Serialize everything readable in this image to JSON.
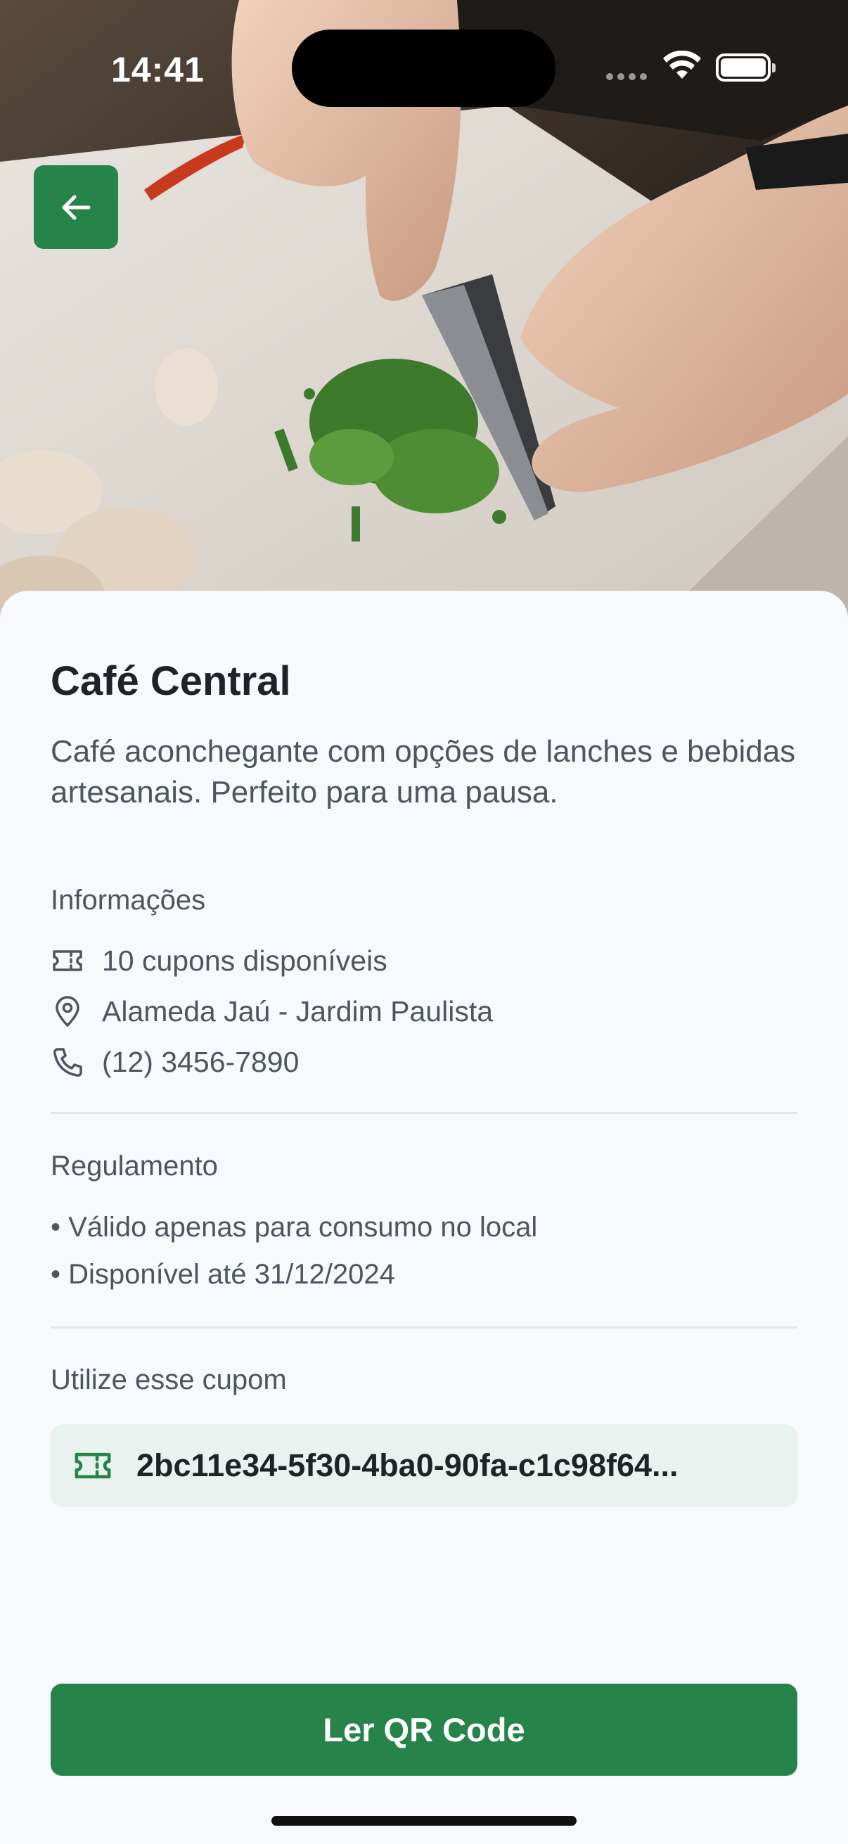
{
  "status_bar": {
    "time": "14:41"
  },
  "hero": {
    "image_description": "",
    "back_icon": "arrow-left-icon"
  },
  "place": {
    "name": "Café Central",
    "description": "Café aconchegante com opções de lanches e bebidas artesanais. Perfeito para uma pausa."
  },
  "info": {
    "heading": "Informações",
    "items": [
      {
        "icon": "ticket-icon",
        "text": "10 cupons disponíveis"
      },
      {
        "icon": "location-pin-icon",
        "text": "Alameda Jaú - Jardim Paulista"
      },
      {
        "icon": "phone-icon",
        "text": "(12) 3456-7890"
      }
    ]
  },
  "rules": {
    "heading": "Regulamento",
    "items": [
      "• Válido apenas para consumo no local",
      "• Disponível até 31/12/2024"
    ]
  },
  "coupon": {
    "heading": "Utilize esse cupom",
    "icon": "ticket-icon",
    "code": "2bc11e34-5f30-4ba0-90fa-c1c98f64..."
  },
  "actions": {
    "scan_label": "Ler QR Code"
  },
  "colors": {
    "accent": "#26834a",
    "coupon_bg": "#e9f2ee",
    "background": "#f7f9fc",
    "text_secondary": "#4d5560"
  }
}
